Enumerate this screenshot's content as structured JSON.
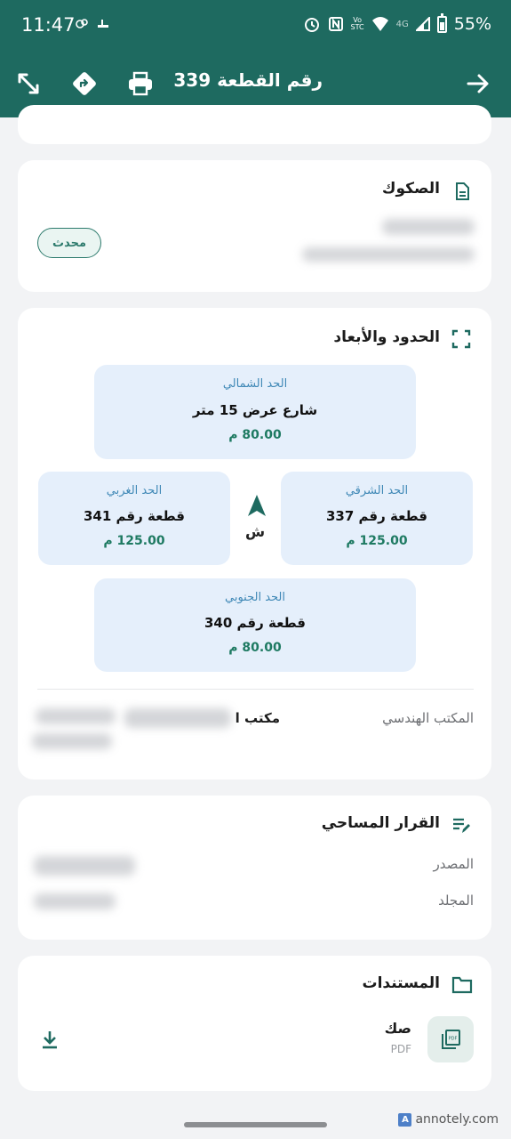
{
  "status_bar": {
    "time": "11:47",
    "network": "4G",
    "carrier_top": "Vo",
    "carrier_bottom": "STC",
    "battery": "55%"
  },
  "app_bar": {
    "title": "رقم القطعة 339",
    "icons": [
      "back-arrow-icon",
      "print-icon",
      "directions-icon",
      "expand-icon"
    ]
  },
  "deeds_card": {
    "title": "الصكوك",
    "status_badge": "محدث"
  },
  "boundaries_card": {
    "title": "الحدود والأبعاد",
    "north": {
      "label": "الحد الشمالي",
      "value": "شارع عرض 15 متر",
      "length": "80.00 م"
    },
    "east": {
      "label": "الحد الشرقي",
      "value": "قطعة رقم 337",
      "length": "125.00 م"
    },
    "west": {
      "label": "الحد الغربي",
      "value": "قطعة رقم 341",
      "length": "125.00 م"
    },
    "south": {
      "label": "الحد الجنوبي",
      "value": "قطعة رقم 340",
      "length": "80.00 م"
    },
    "compass_label": "ش",
    "engineering_office_label": "المكتب الهندسي",
    "engineering_office_value": "مكتب ا"
  },
  "survey_card": {
    "title": "القرار المساحي",
    "source_label": "المصدر",
    "volume_label": "المجلد"
  },
  "documents_card": {
    "title": "المستندات",
    "items": [
      {
        "name": "صك",
        "type": "PDF"
      }
    ]
  },
  "watermark": "annotely.com",
  "watermark_logo": "A",
  "colors": {
    "primary": "#1e6a60",
    "accent_green": "#1e7a62",
    "label_blue": "#3f88b6",
    "box_bg": "#e5effb"
  }
}
